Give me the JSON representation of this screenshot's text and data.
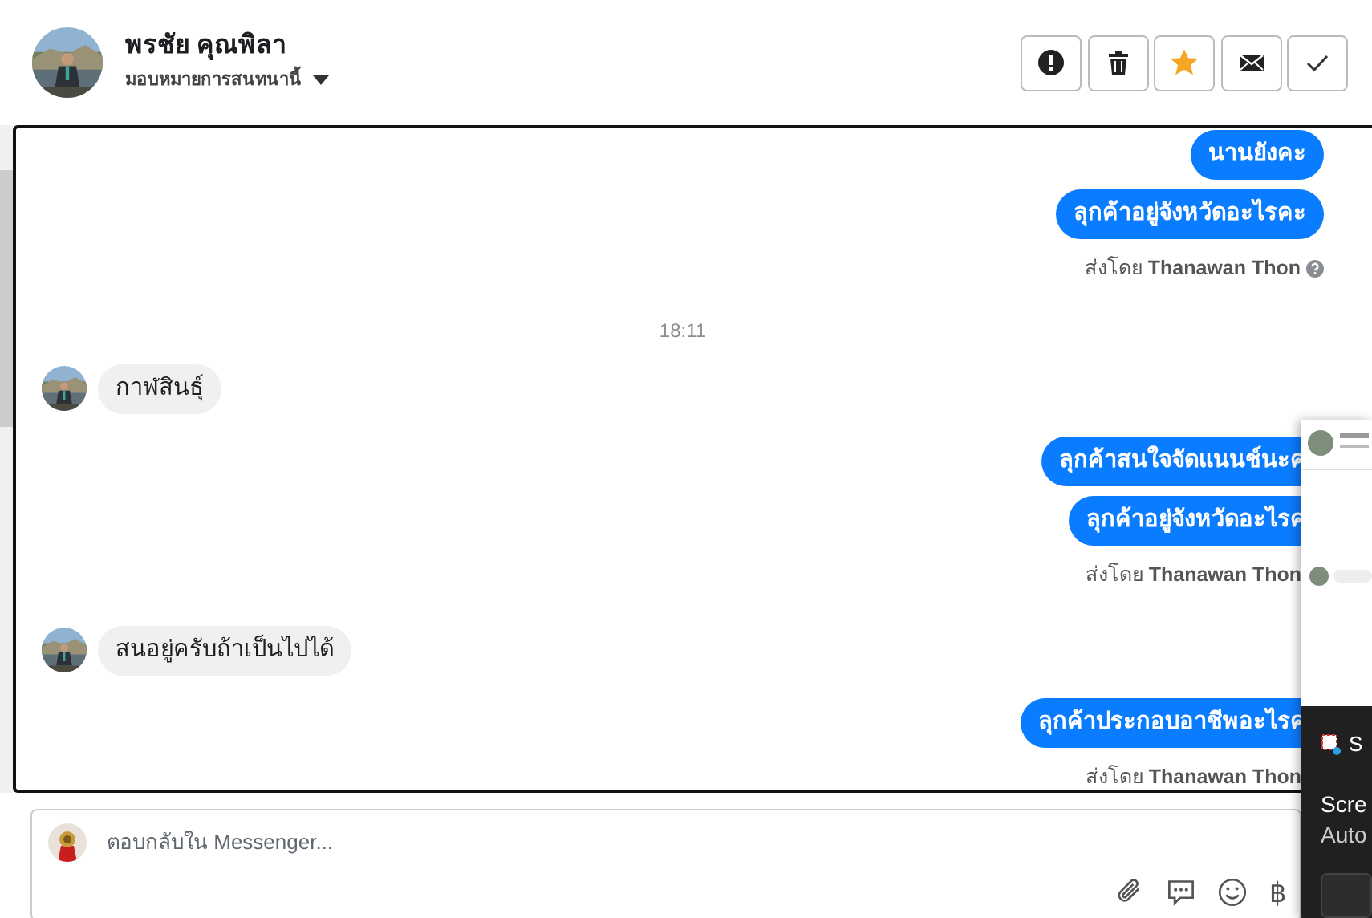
{
  "header": {
    "name": "พรชัย คุณพิลา",
    "assign_label": "มอบหมายการสนทนานี้",
    "actions": [
      {
        "kind": "report"
      },
      {
        "kind": "delete"
      },
      {
        "kind": "star",
        "on": true
      },
      {
        "kind": "mail"
      },
      {
        "kind": "done"
      }
    ]
  },
  "messages": [
    {
      "kind": "outgoing",
      "text": "นานยังคะ"
    },
    {
      "kind": "outgoing",
      "text": "ลุกค้าอยู่จังหวัดอะไรคะ"
    },
    {
      "kind": "sent_by",
      "text": "ส่งโดย **Thanawan Thon**",
      "help": true
    },
    {
      "kind": "time",
      "text": "18:11"
    },
    {
      "kind": "incoming",
      "text": "กาฬสินธุ์"
    },
    {
      "kind": "outgoing",
      "text": "ลุกค้าสนใจจัดแนนช์นะค"
    },
    {
      "kind": "outgoing",
      "text": "ลุกค้าอยู่จังหวัดอะไรค"
    },
    {
      "kind": "sent_by",
      "text": "ส่งโดย **Thanawan Thon**",
      "help": false
    },
    {
      "kind": "incoming",
      "text": "สนอยู่ครับถ้าเป็นไปได้"
    },
    {
      "kind": "outgoing",
      "text": "ลุกค้าประกอบอาชีพอะไรค"
    },
    {
      "kind": "sent_by",
      "text": "ส่งโดย **Thanawan Thon**",
      "help": false
    }
  ],
  "composer": {
    "placeholder": "ตอบกลับใน Messenger...",
    "tools": [
      {
        "kind": "attach"
      },
      {
        "kind": "saved_reply"
      },
      {
        "kind": "emoji"
      },
      {
        "kind": "text",
        "text": "฿"
      }
    ]
  },
  "notification": {
    "title": "S",
    "line_1": "Scre",
    "line_2": "Auto"
  }
}
